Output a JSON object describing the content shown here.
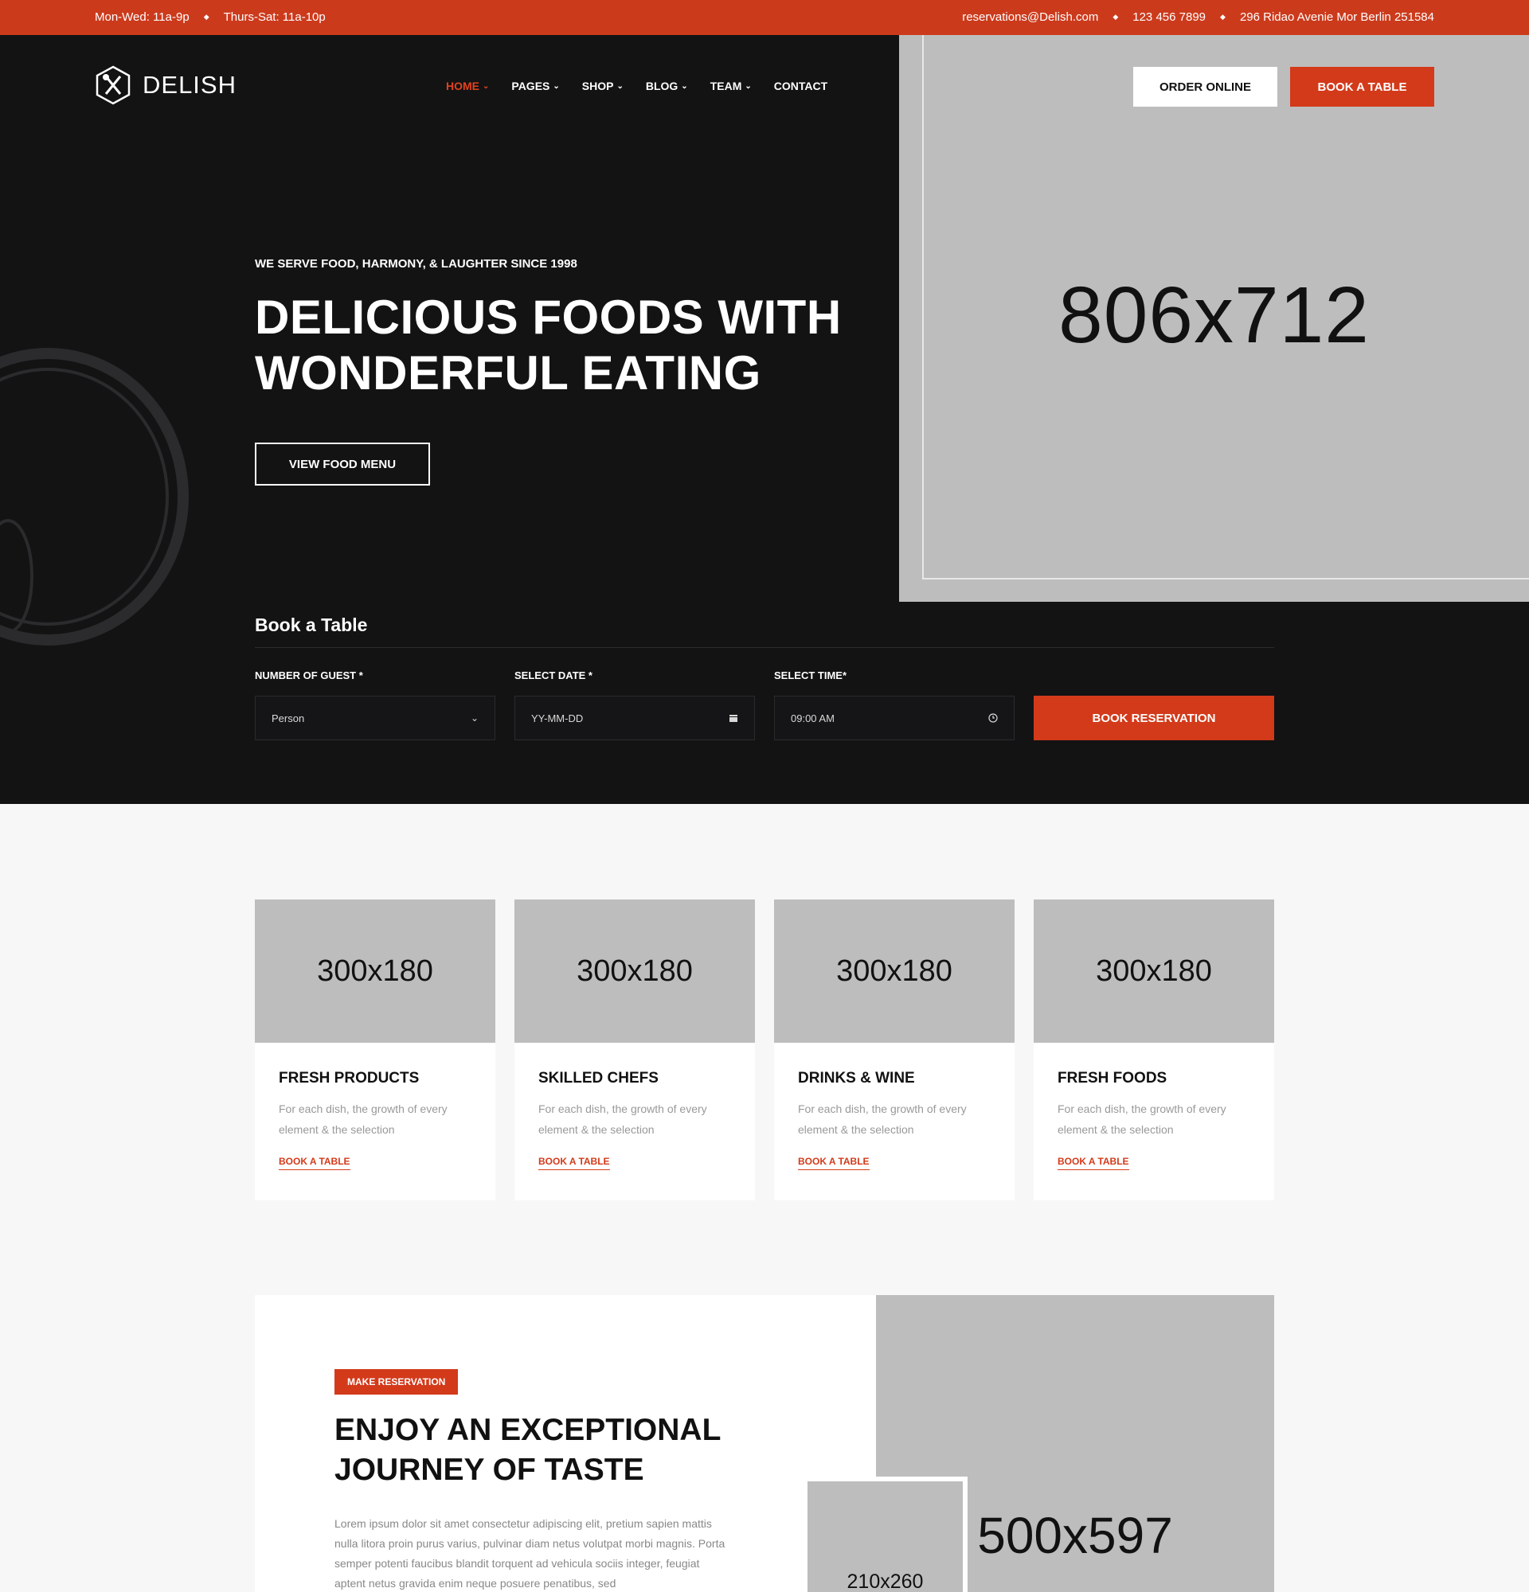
{
  "topbar": {
    "hours_1": "Mon-Wed: 11a-9p",
    "hours_2": "Thurs-Sat: 11a-10p",
    "email": "reservations@Delish.com",
    "phone": "123 456 7899",
    "address": "296 Ridao Avenie Mor Berlin 251584"
  },
  "header": {
    "logo_text": "DELISH",
    "nav": [
      {
        "label": "HOME"
      },
      {
        "label": "PAGES"
      },
      {
        "label": "SHOP"
      },
      {
        "label": "BLOG"
      },
      {
        "label": "TEAM"
      },
      {
        "label": "CONTACT"
      }
    ],
    "order_online": "ORDER ONLINE",
    "book_table": "BOOK A TABLE"
  },
  "hero": {
    "eyebrow": "WE SERVE FOOD, HARMONY, & LAUGHTER SINCE 1998",
    "title_line1": "DELICIOUS FOODS WITH",
    "title_line2": "WONDERFUL EATING",
    "menu_button": "VIEW FOOD MENU",
    "image_placeholder": "806x712"
  },
  "booking": {
    "title": "Book a Table",
    "guest_label": "NUMBER OF GUEST *",
    "guest_value": "Person",
    "date_label": "SELECT DATE *",
    "date_placeholder": "YY-MM-DD",
    "time_label": "SELECT TIME*",
    "time_value": "09:00 AM",
    "submit": "BOOK RESERVATION"
  },
  "features": [
    {
      "image": "300x180",
      "title": "FRESH PRODUCTS",
      "desc": "For each dish, the growth of every element & the selection",
      "link": "BOOK A TABLE"
    },
    {
      "image": "300x180",
      "title": "SKILLED CHEFS",
      "desc": "For each dish, the growth of every element & the selection",
      "link": "BOOK A TABLE"
    },
    {
      "image": "300x180",
      "title": "DRINKS & WINE",
      "desc": "For each dish, the growth of every element & the selection",
      "link": "BOOK A TABLE"
    },
    {
      "image": "300x180",
      "title": "FRESH FOODS",
      "desc": "For each dish, the growth of every element & the selection",
      "link": "BOOK A TABLE"
    }
  ],
  "about": {
    "tag": "MAKE RESERVATION",
    "title_line1": "ENJOY AN EXCEPTIONAL",
    "title_line2": "JOURNEY OF TASTE",
    "text": "Lorem ipsum dolor sit amet consectetur adipiscing elit, pretium sapien mattis nulla litora proin purus varius, pulvinar diam netus volutpat morbi magnis. Porta semper potenti faucibus blandit torquent ad vehicula sociis integer, feugiat aptent netus gravida enim neque posuere penatibus, sed",
    "big_image": "500x597",
    "small_image": "210x260"
  },
  "colors": {
    "accent": "#d33a1a",
    "hero_bg": "#131314",
    "placeholder": "#bdbdbd"
  }
}
